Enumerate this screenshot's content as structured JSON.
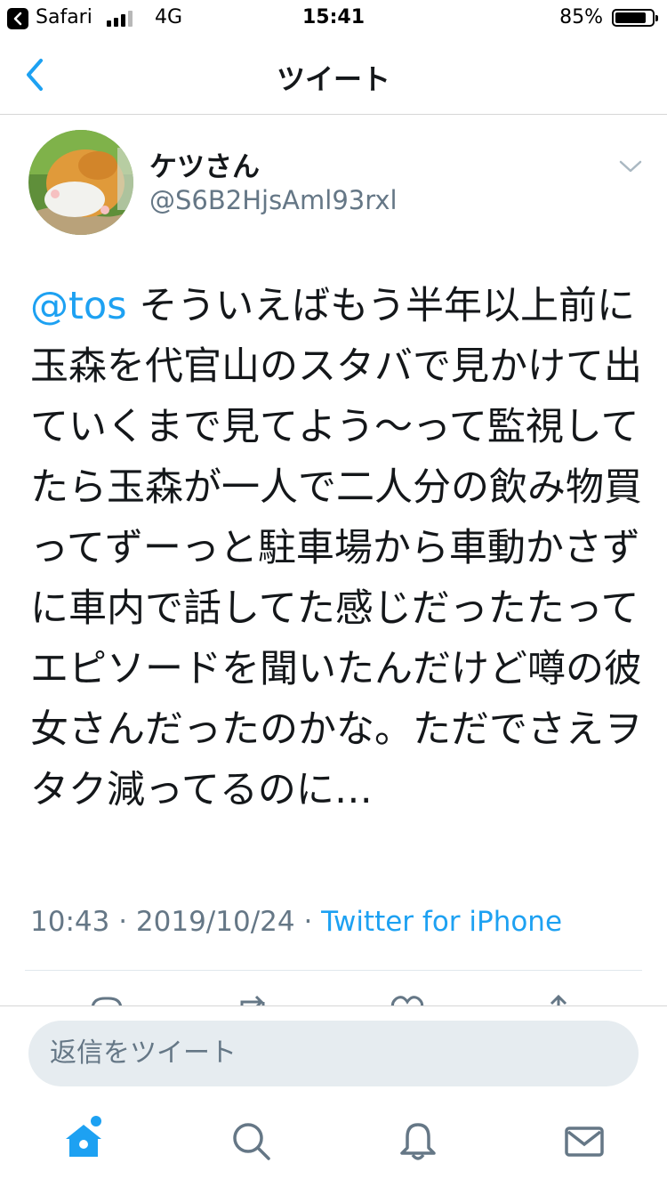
{
  "status_bar": {
    "app": "Safari",
    "network": "4G",
    "time": "15:41",
    "battery": "85%",
    "battery_level": 0.85
  },
  "nav": {
    "title": "ツイート"
  },
  "tweet": {
    "author_name": "ケツさん",
    "author_handle": "@S6B2HjsAml93rxl",
    "mention": "@tos",
    "text": " そういえばもう半年以上前に玉森を代官山のスタバで見かけて出ていくまで見てよう〜って監視してたら玉森が一人で二人分の飲み物買ってずーっと駐車場から車動かさずに車内で話してた感じだったたってエピソードを聞いたんだけど噂の彼女さんだったのかな。ただでさえヲタク減ってるのに…",
    "time": "10:43",
    "date": "2019/10/24",
    "separator": " · ",
    "source": "Twitter for iPhone"
  },
  "reply": {
    "placeholder": "返信をツイート"
  },
  "colors": {
    "accent": "#1da1f2",
    "secondary_text": "#657786",
    "divider": "#e1e8ed",
    "input_bg": "#e6ecf0"
  },
  "icons": {
    "back": "chevron-left-icon",
    "caret": "chevron-down-icon",
    "home": "home-icon",
    "search": "search-icon",
    "notifications": "bell-icon",
    "messages": "envelope-icon"
  }
}
